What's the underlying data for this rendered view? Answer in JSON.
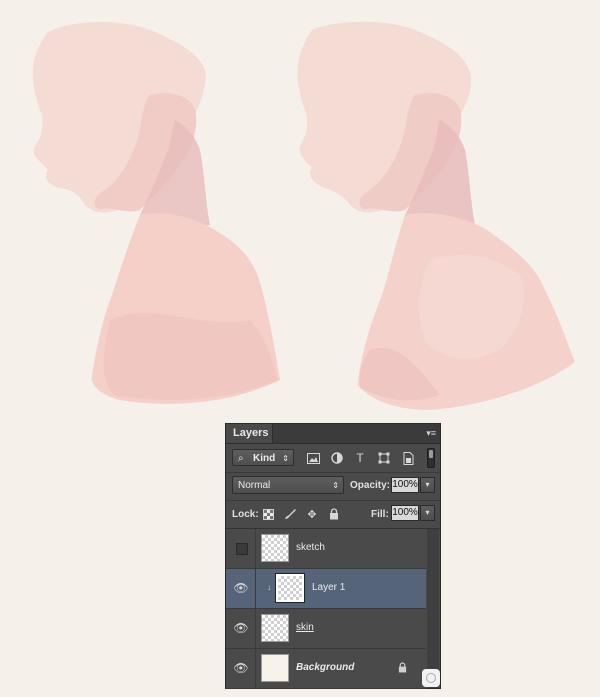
{
  "panel": {
    "tab_label": "Layers",
    "menu_icon": "panel-menu-icon"
  },
  "filter": {
    "kind_label": "Kind",
    "icons": [
      "pixel-filter-icon",
      "adjustment-filter-icon",
      "type-filter-icon",
      "shape-filter-icon",
      "smart-object-filter-icon"
    ]
  },
  "blend": {
    "mode": "Normal",
    "opacity_label": "Opacity:",
    "opacity_value": "100%"
  },
  "lock": {
    "label": "Lock:",
    "fill_label": "Fill:",
    "fill_value": "100%"
  },
  "layers": [
    {
      "name": "sketch",
      "visible": false,
      "selected": false
    },
    {
      "name": "Layer 1",
      "visible": true,
      "selected": true,
      "clipped": true
    },
    {
      "name": "skin",
      "visible": true,
      "selected": false
    },
    {
      "name": "Background",
      "visible": true,
      "selected": false,
      "locked": true
    }
  ],
  "colors": {
    "canvas_bg": "#f5f1ea",
    "skin_fill": "#f4cfc8",
    "skin_shadow": "#e3b2b3",
    "selected_layer": "#56647a",
    "panel_bg": "#4a4a4a"
  }
}
